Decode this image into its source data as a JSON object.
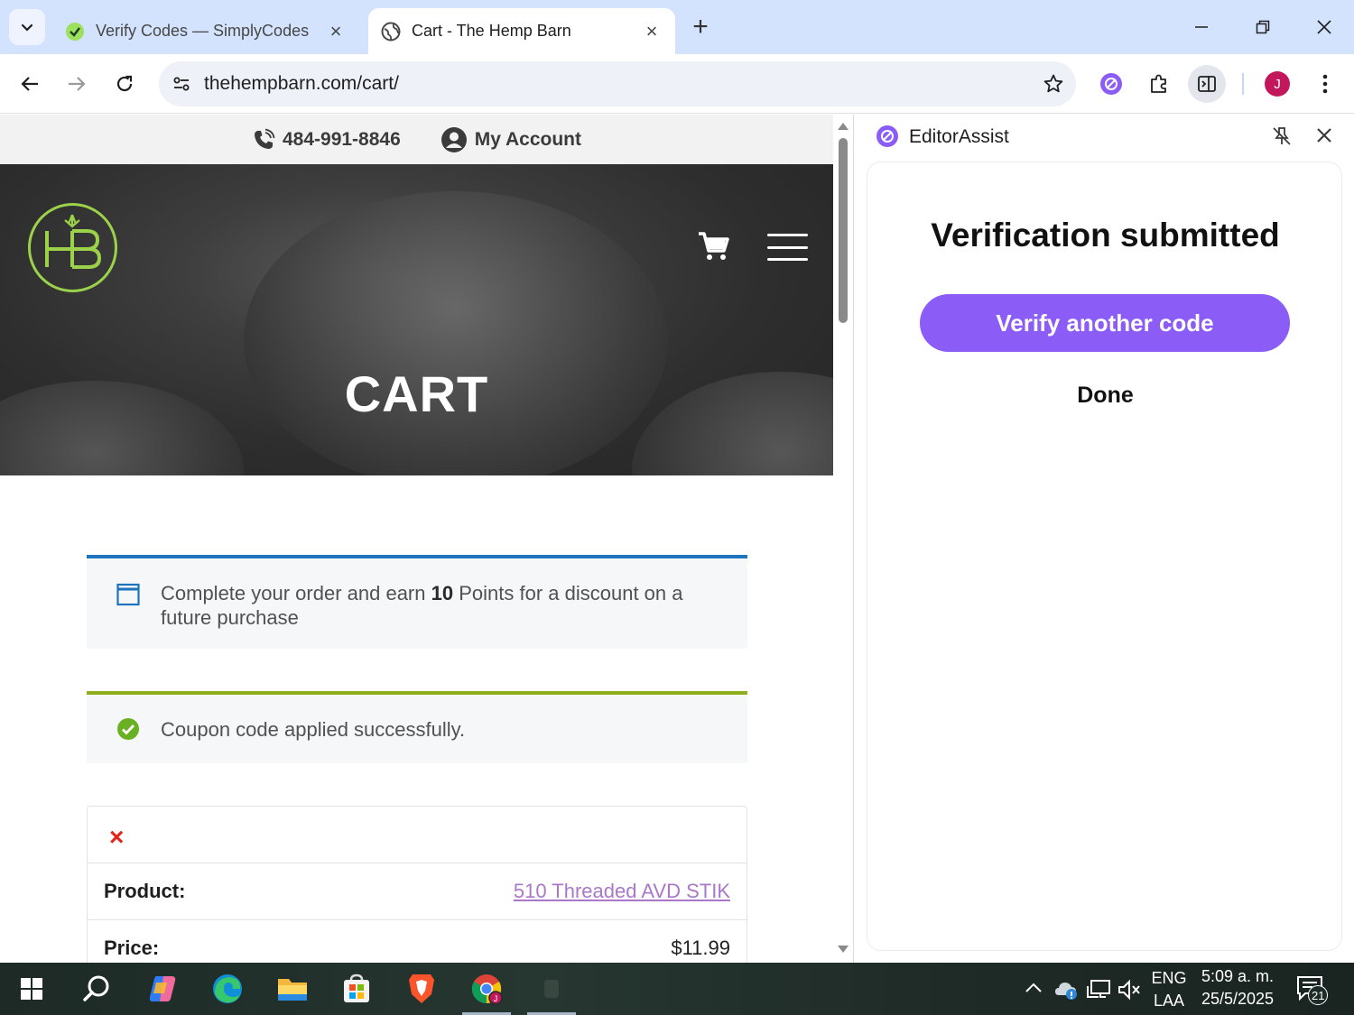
{
  "browser": {
    "tabs": [
      {
        "title": "Verify Codes — SimplyCodes",
        "active": false
      },
      {
        "title": "Cart - The Hemp Barn",
        "active": true
      }
    ],
    "url": "thehempbarn.com/cart/",
    "profile_initial": "J"
  },
  "site": {
    "phone": "484-991-8846",
    "account_label": "My Account",
    "page_title": "CART",
    "notice_points": {
      "prefix": "Complete your order and earn ",
      "points": "10",
      "suffix": " Points for a discount on a future purchase"
    },
    "notice_coupon": "Coupon code applied successfully.",
    "remove_symbol": "×",
    "cart": {
      "product_label": "Product:",
      "product_value": "510 Threaded AVD STIK",
      "price_label": "Price:",
      "price_value": "$11.99"
    },
    "colors": {
      "info_border": "#1e73be",
      "success_border": "#8fae1b",
      "logo_green": "#9bd24a",
      "link": "#a978c8"
    }
  },
  "sidepanel": {
    "title": "EditorAssist",
    "heading": "Verification submitted",
    "primary_button": "Verify another code",
    "secondary_button": "Done",
    "accent_color": "#8b5cf6"
  },
  "taskbar": {
    "language": "ENG",
    "layout": "LAA",
    "time": "5:09 a. m.",
    "date": "25/5/2025",
    "notification_count": "21",
    "apps": [
      "start-icon",
      "search-icon",
      "copilot-icon",
      "edge-icon",
      "file-explorer-icon",
      "microsoft-store-icon",
      "brave-icon",
      "chrome-icon",
      "taskbar-app-icon"
    ]
  }
}
